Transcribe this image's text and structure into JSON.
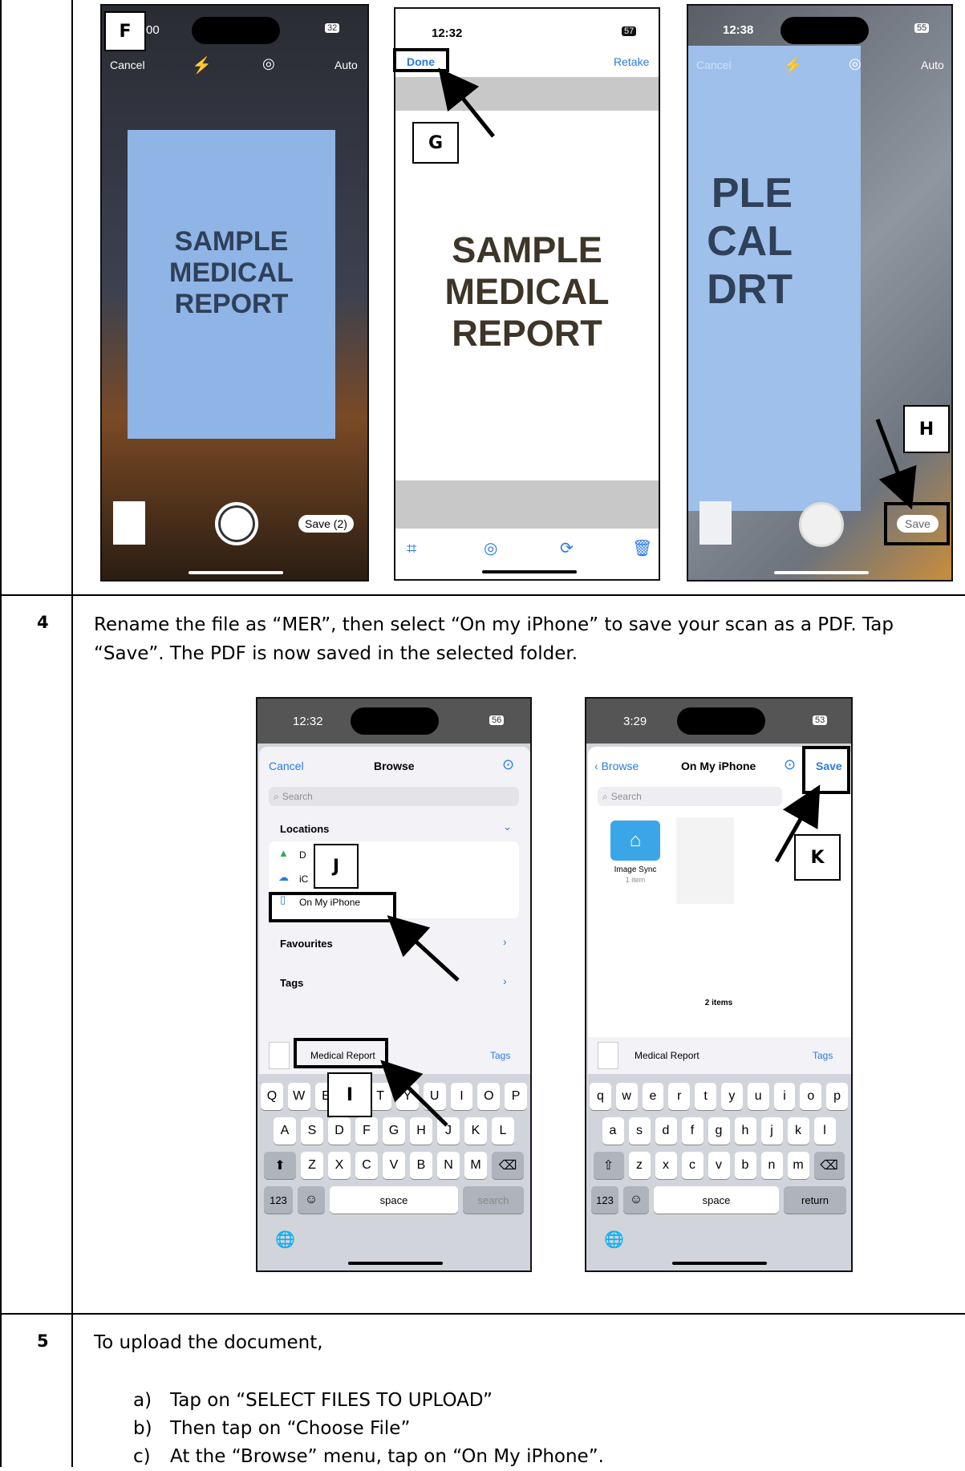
{
  "steps": [
    {
      "number": "4",
      "text_line1": "Rename the file as “MER”, then select “On my iPhone” to save your scan as a PDF. Tap",
      "text_line2": "“Save”. The PDF is now saved in the selected folder."
    },
    {
      "number": "5",
      "intro": "To upload the document,",
      "items": [
        {
          "marker": "a)",
          "text": "Tap on “SELECT FILES TO UPLOAD”"
        },
        {
          "marker": "b)",
          "text": "Then tap on “Choose File”"
        },
        {
          "marker": "c)",
          "text": "At the “Browse” menu, tap on “On My iPhone”."
        }
      ]
    }
  ],
  "callouts": {
    "F": "F",
    "G": "G",
    "H": "H",
    "I": "I",
    "J": "J",
    "K": "K"
  },
  "document_text": [
    "SAMPLE",
    "MEDICAL",
    "REPORT"
  ],
  "phone1": {
    "time": "00",
    "battery": "32",
    "cancel": "Cancel",
    "auto": "Auto",
    "save": "Save (2)"
  },
  "phone2": {
    "time": "12:32",
    "battery": "57",
    "done": "Done",
    "retake": "Retake"
  },
  "phone3": {
    "time": "12:38",
    "battery": "55",
    "cancel": "Cancel",
    "auto": "Auto",
    "partial": [
      "PLE",
      "CAL",
      "DRT"
    ],
    "save": "Save"
  },
  "phone4": {
    "time": "12:32",
    "battery": "56",
    "cancel": "Cancel",
    "title": "Browse",
    "search": "Search",
    "locations": "Locations",
    "loc_items": [
      "D",
      "iC",
      "On My iPhone"
    ],
    "favourites": "Favourites",
    "tags": "Tags",
    "filename": "Medical Report",
    "tags_btn": "Tags",
    "row1": [
      "Q",
      "W",
      "E",
      "R",
      "T",
      "Y",
      "U",
      "I",
      "O",
      "P"
    ],
    "row2": [
      "A",
      "S",
      "D",
      "F",
      "G",
      "H",
      "J",
      "K",
      "L"
    ],
    "row3": [
      "Z",
      "X",
      "C",
      "V",
      "B",
      "N",
      "M"
    ],
    "k123": "123",
    "space": "space",
    "action": "search"
  },
  "phone5": {
    "time": "3:29",
    "battery": "53",
    "back": "Browse",
    "title": "On My iPhone",
    "save": "Save",
    "search": "Search",
    "folder_name": "Image Sync",
    "folder_meta": "1 item",
    "count": "2 items",
    "filename": "Medical Report",
    "tags_btn": "Tags",
    "row1": [
      "q",
      "w",
      "e",
      "r",
      "t",
      "y",
      "u",
      "i",
      "o",
      "p"
    ],
    "row2": [
      "a",
      "s",
      "d",
      "f",
      "g",
      "h",
      "j",
      "k",
      "l"
    ],
    "row3": [
      "z",
      "x",
      "c",
      "v",
      "b",
      "n",
      "m"
    ],
    "k123": "123",
    "space": "space",
    "action": "return"
  },
  "colors": {
    "ios_blue": "#2a7ae2",
    "paper_blue": "#8fb4e6",
    "desk": "#3b2a1d"
  }
}
